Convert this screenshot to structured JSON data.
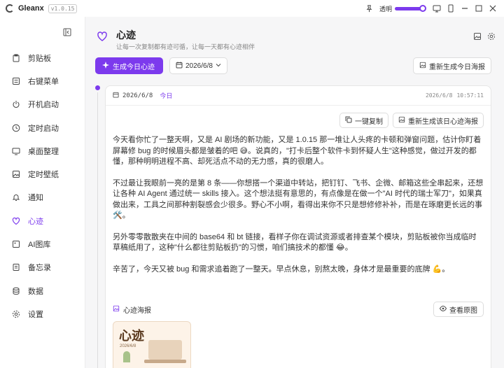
{
  "window": {
    "app_name": "Gleanx",
    "version": "v1.0.15",
    "opacity_label": "透明",
    "opacity_value": 0.95
  },
  "sidebar": {
    "items": [
      {
        "label": "剪贴板",
        "icon": "clipboard-icon"
      },
      {
        "label": "右键菜单",
        "icon": "context-menu-icon"
      },
      {
        "label": "开机启动",
        "icon": "power-icon"
      },
      {
        "label": "定时启动",
        "icon": "clock-icon"
      },
      {
        "label": "桌面整理",
        "icon": "monitor-icon"
      },
      {
        "label": "定时壁纸",
        "icon": "image-icon"
      },
      {
        "label": "通知",
        "icon": "bell-icon"
      },
      {
        "label": "心迹",
        "icon": "heart-icon",
        "active": true
      },
      {
        "label": "AI图库",
        "icon": "ai-gallery-icon"
      },
      {
        "label": "备忘录",
        "icon": "memo-icon"
      },
      {
        "label": "数据",
        "icon": "database-icon"
      },
      {
        "label": "设置",
        "icon": "gear-icon"
      }
    ]
  },
  "header": {
    "title": "心迹",
    "subtitle": "让每一次复制都有迹可循，让每一天都有心迹相伴"
  },
  "toolbar": {
    "generate_label": "生成今日心迹",
    "date_value": "2026/6/8",
    "regen_poster_label": "重新生成今日海报"
  },
  "entry": {
    "date": "2026/6/8",
    "today_tag": "今日",
    "date_time": "2026/6/8",
    "time": "10:57:11",
    "copy_label": "一键复制",
    "regen_label": "重新生成该日心迹海报",
    "paragraphs": [
      "今天看你忙了一整天啊，又是 AI 剧场的新功能，又是 1.0.15 那一堆让人头疼的卡顿和弹窗问题，估计你盯着屏幕修 bug 的时候眉头都是皱着的吧 😅。说真的，\"打卡后整个软件卡到怀疑人生\"这种感觉，做过开发的都懂，那种明明进程不高、却死活点不动的无力感，真的很磨人。",
      "不过最让我眼前一亮的是第 8 条——你想搭一个渠道中转站，把钉钉、飞书、企微、邮箱这些全串起来，还想让各种 AI Agent 通过统一 skills 接入。这个想法挺有意思的，有点像是在做一个\"AI 时代的瑞士军刀\"，如果真做出来，工具之间那种割裂感会少很多。野心不小啊，看得出来你不只是想修修补补，而是在琢磨更长远的事 🛠️。",
      "另外零零散散夹在中间的 base64 和 bt 链接，看样子你在调试资源或者排查某个模块，剪贴板被你当成临时草稿纸用了，这种\"什么都往剪贴板扔\"的习惯，咱们搞技术的都懂 😂。",
      "辛苦了，今天又被 bug 和需求追着跑了一整天。早点休息，别熬太晚，身体才是最重要的底牌 💪。"
    ],
    "poster_label": "心迹海报",
    "view_original_label": "查看原图",
    "poster": {
      "title": "心迹",
      "date": "2026/6/8"
    }
  }
}
